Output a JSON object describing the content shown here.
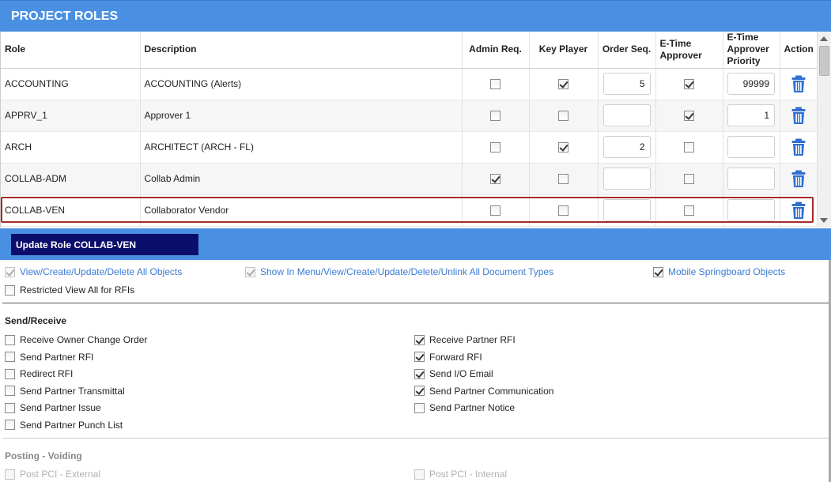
{
  "header": {
    "title": "PROJECT ROLES"
  },
  "table": {
    "columns": {
      "role": "Role",
      "description": "Description",
      "admin_req": "Admin Req.",
      "key_player": "Key Player",
      "order_seq": "Order Seq.",
      "etime_approver": "E-Time Approver",
      "etime_priority": "E-Time Approver Priority",
      "action": "Action"
    },
    "rows": [
      {
        "role": "ACCOUNTING",
        "description": "ACCOUNTING (Alerts)",
        "admin_req": false,
        "key_player": true,
        "order_seq": "5",
        "etime_approver": true,
        "etime_priority": "99999"
      },
      {
        "role": "APPRV_1",
        "description": "Approver 1",
        "admin_req": false,
        "key_player": false,
        "order_seq": "",
        "etime_approver": true,
        "etime_priority": "1"
      },
      {
        "role": "ARCH",
        "description": "ARCHITECT (ARCH - FL)",
        "admin_req": false,
        "key_player": true,
        "order_seq": "2",
        "etime_approver": false,
        "etime_priority": ""
      },
      {
        "role": "COLLAB-ADM",
        "description": "Collab Admin",
        "admin_req": true,
        "key_player": false,
        "order_seq": "",
        "etime_approver": false,
        "etime_priority": ""
      },
      {
        "role": "COLLAB-VEN",
        "description": "Collaborator Vendor",
        "admin_req": false,
        "key_player": false,
        "order_seq": "",
        "etime_approver": false,
        "etime_priority": ""
      }
    ],
    "selected_row": 4
  },
  "update": {
    "title": "Update Role COLLAB-VEN",
    "global_perms": [
      {
        "label": "View/Create/Update/Delete All Objects",
        "checked": true,
        "disabled": true
      },
      {
        "label": "Show In Menu/View/Create/Update/Delete/Unlink All Document Types",
        "checked": true,
        "disabled": true
      },
      {
        "label": "Mobile Springboard Objects",
        "checked": true,
        "disabled": false
      },
      {
        "label": "Restricted View All for RFIs",
        "checked": false,
        "disabled": false
      }
    ],
    "send_receive": {
      "title": "Send/Receive",
      "left": [
        {
          "label": "Receive Owner Change Order",
          "checked": false
        },
        {
          "label": "Send Partner RFI",
          "checked": false
        },
        {
          "label": "Redirect RFI",
          "checked": false
        },
        {
          "label": "Send Partner Transmittal",
          "checked": false
        },
        {
          "label": "Send Partner Issue",
          "checked": false
        },
        {
          "label": "Send Partner Punch List",
          "checked": false
        }
      ],
      "right": [
        {
          "label": "Receive Partner RFI",
          "checked": true
        },
        {
          "label": "Forward RFI",
          "checked": true
        },
        {
          "label": "Send I/O Email",
          "checked": true
        },
        {
          "label": "Send Partner Communication",
          "checked": true
        },
        {
          "label": "Send Partner Notice",
          "checked": false
        }
      ]
    },
    "posting": {
      "title": "Posting - Voiding",
      "left": [
        {
          "label": "Post PCI - External",
          "checked": false
        }
      ],
      "right": [
        {
          "label": "Post PCI - Internal",
          "checked": false
        }
      ]
    }
  },
  "colors": {
    "header_bg": "#4a90e2",
    "update_title_bg": "#0c0e6b",
    "link": "#3a7bd5",
    "selection_border": "#a82a2a",
    "trash": "#2f6fd1"
  },
  "icons": {
    "delete": "trash-icon"
  }
}
